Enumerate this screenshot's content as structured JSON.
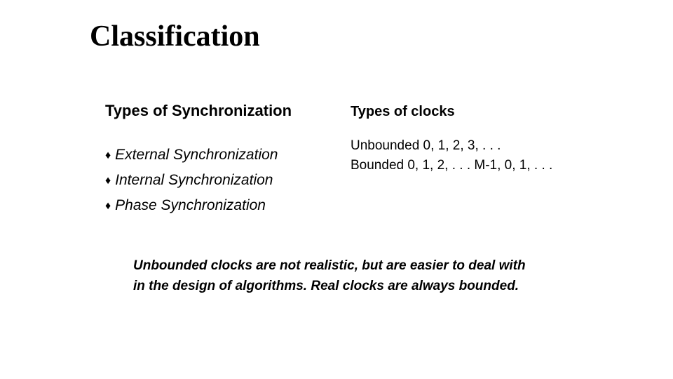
{
  "title": "Classification",
  "left": {
    "heading": "Types of Synchronization",
    "items": [
      "External Synchronization",
      "Internal Synchronization",
      "Phase Synchronization"
    ]
  },
  "right": {
    "heading": "Types of clocks",
    "lines": [
      "Unbounded  0, 1, 2, 3, . . .",
      "Bounded 0, 1, 2, . . . M-1, 0, 1, . . ."
    ]
  },
  "footer": "Unbounded clocks are not realistic, but are easier to deal with in the design of  algorithms. Real clocks are always bounded."
}
